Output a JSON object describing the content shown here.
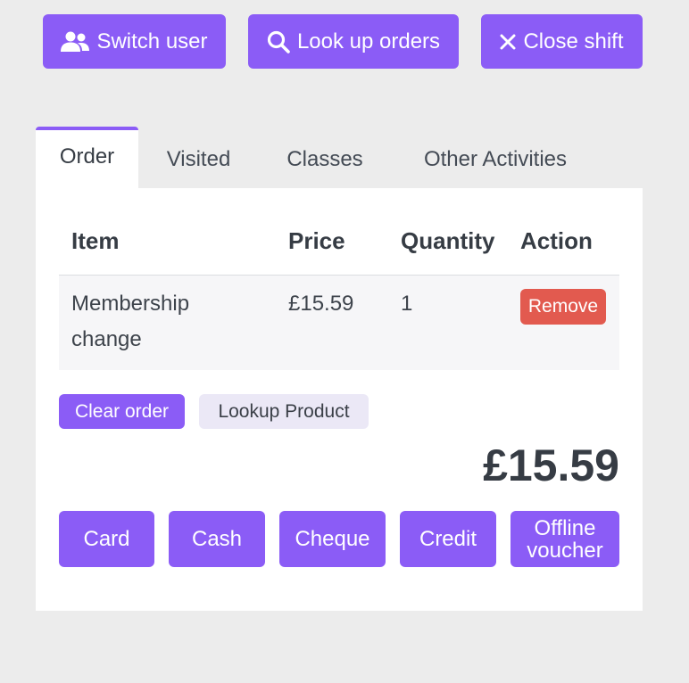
{
  "topbar": {
    "switch_user": {
      "label": "Switch user",
      "icon": "users-icon"
    },
    "look_up_orders": {
      "label": "Look up orders",
      "icon": "search-icon"
    },
    "close_shift": {
      "label": "Close shift",
      "icon": "close-icon"
    }
  },
  "tabs": [
    {
      "label": "Order",
      "active": true
    },
    {
      "label": "Visited",
      "active": false
    },
    {
      "label": "Classes",
      "active": false
    },
    {
      "label": "Other Activities",
      "active": false
    }
  ],
  "order_table": {
    "headers": [
      "Item",
      "Price",
      "Quantity",
      "Action"
    ],
    "rows": [
      {
        "item": "Membership change",
        "price": "£15.59",
        "quantity": "1",
        "action": "Remove"
      }
    ]
  },
  "actions": {
    "clear_order": "Clear order",
    "lookup_product": "Lookup Product"
  },
  "total": "£15.59",
  "payment_methods": [
    "Card",
    "Cash",
    "Cheque",
    "Credit",
    "Offline voucher"
  ],
  "colors": {
    "accent": "#8b5cf6",
    "danger": "#e25a4f",
    "secondary_bg": "#ebe8f6",
    "page_bg": "#ececec"
  }
}
